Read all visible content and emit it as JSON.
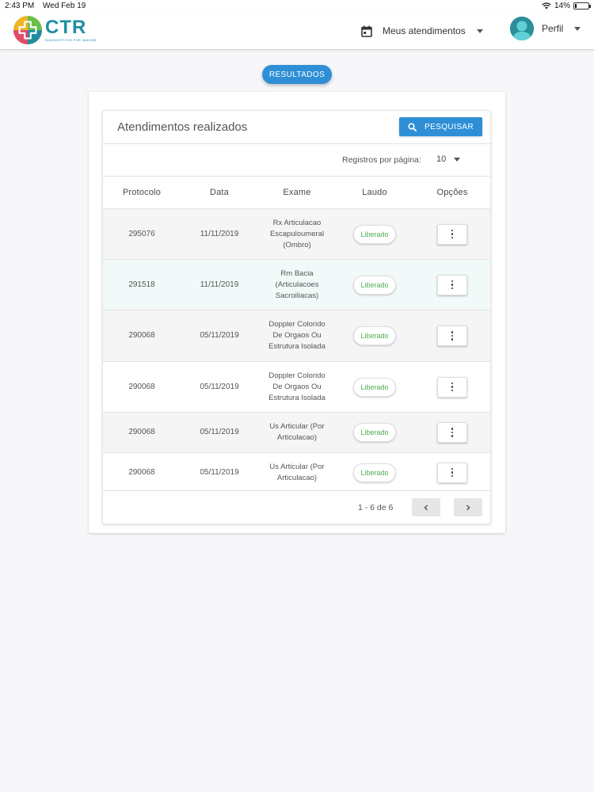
{
  "status_bar": {
    "time": "2:43 PM",
    "date": "Wed Feb 19",
    "battery": "14%",
    "battery_level": 0.14
  },
  "header": {
    "logo_text": "CTR",
    "logo_tagline": "DIAGNÓSTICOS POR IMAGEM",
    "menu_atendimentos": "Meus atendimentos",
    "menu_perfil": "Perfil"
  },
  "resultados_label": "RESULTADOS",
  "card": {
    "title": "Atendimentos realizados",
    "search_button": "PESQUISAR",
    "per_page_label": "Registros por página:",
    "per_page_value": "10"
  },
  "table": {
    "headers": [
      "Protocolo",
      "Data",
      "Exame",
      "Laudo",
      "Opções"
    ],
    "rows": [
      {
        "protocolo": "295076",
        "data": "11/11/2019",
        "exame": "Rx Articulacao Escapuloumeral (Ombro)",
        "laudo": "Liberado"
      },
      {
        "protocolo": "291518",
        "data": "11/11/2019",
        "exame": "Rm Bacia (Articulacoes Sacroiliacas)",
        "laudo": "Liberado"
      },
      {
        "protocolo": "290068",
        "data": "05/11/2019",
        "exame": "Doppler Colorido De Orgaos Ou Estrutura Isolada",
        "laudo": "Liberado"
      },
      {
        "protocolo": "290068",
        "data": "05/11/2019",
        "exame": "Doppler Colorido De Orgaos Ou Estrutura Isolada",
        "laudo": "Liberado"
      },
      {
        "protocolo": "290068",
        "data": "05/11/2019",
        "exame": "Us Articular (Por Articulacao)",
        "laudo": "Liberado"
      },
      {
        "protocolo": "290068",
        "data": "05/11/2019",
        "exame": "Us Articular (Por Articulacao)",
        "laudo": "Liberado"
      }
    ]
  },
  "pagination": {
    "range": "1 - 6 de 6"
  },
  "colors": {
    "accent": "#2f8fd6",
    "brand": "#1f8fa0",
    "status_liberado": "#4caf50",
    "highlight_row": "#f2f9f9",
    "striped_row": "#f5f5f5"
  }
}
